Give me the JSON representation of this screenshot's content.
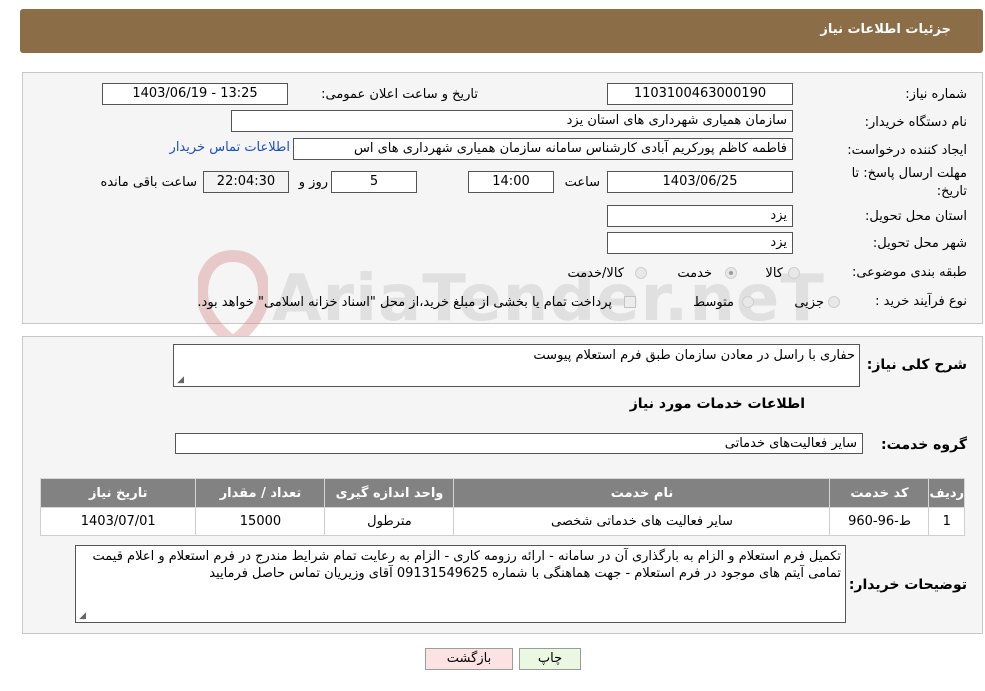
{
  "header": {
    "title": "جزئیات اطلاعات نیاز"
  },
  "watermark": "AriaTender.neT",
  "form": {
    "need_number_label": "شماره نیاز:",
    "need_number": "1103100463000190",
    "announce_label": "تاریخ و ساعت اعلان عمومی:",
    "announce_value": "1403/06/19 - 13:25",
    "buyer_org_label": "نام دستگاه خریدار:",
    "buyer_org": "سازمان همیاری شهرداری های استان یزد",
    "creator_label": "ایجاد کننده درخواست:",
    "creator": "فاطمه کاظم پورکریم آبادی کارشناس سامانه سازمان همیاری شهرداری های اس",
    "contact_link": "اطلاعات تماس خریدار",
    "deadline_label_1": "مهلت ارسال پاسخ: تا",
    "deadline_label_2": "تاریخ:",
    "deadline_date": "1403/06/25",
    "time_label": "ساعت",
    "deadline_time": "14:00",
    "days": "5",
    "days_label": "روز و",
    "remaining_time": "22:04:30",
    "remaining_label": "ساعت باقی مانده",
    "province_label": "استان محل تحویل:",
    "province": "یزد",
    "city_label": "شهر محل تحویل:",
    "city": "یزد",
    "category_label": "طبقه بندی موضوعی:",
    "category_options": [
      "کالا",
      "خدمت",
      "کالا/خدمت"
    ],
    "category_selected": "خدمت",
    "purchase_type_label": "نوع فرآیند خرید :",
    "purchase_options": [
      "جزیی",
      "متوسط"
    ],
    "payment_note": "پرداخت تمام یا بخشی از مبلغ خرید،از محل \"اسناد خزانه اسلامی\" خواهد بود."
  },
  "details": {
    "general_desc_label": "شرح کلی نیاز:",
    "general_desc": "حفاری با راسل در معادن سازمان طبق فرم استعلام پیوست",
    "services_title": "اطلاعات خدمات مورد نیاز",
    "service_group_label": "گروه خدمت:",
    "service_group": "سایر فعالیت‌های خدماتی",
    "table": {
      "headers": [
        "ردیف",
        "کد خدمت",
        "نام خدمت",
        "واحد اندازه گیری",
        "تعداد / مقدار",
        "تاریخ نیاز"
      ],
      "rows": [
        [
          "1",
          "ط-96-960",
          "سایر فعالیت های خدماتی شخصی",
          "مترطول",
          "15000",
          "1403/07/01"
        ]
      ]
    },
    "buyer_notes_label": "توضیحات خریدار:",
    "buyer_notes": "تکمیل فرم استعلام و الزام به بارگذاری آن در سامانه - ارائه رزومه کاری - الزام به رعایت تمام شرایط مندرج در فرم استعلام و اعلام قیمت تمامی آیتم های موجود در فرم استعلام - جهت هماهنگی با شماره 09131549625 آقای وزیریان تماس حاصل فرمایید"
  },
  "buttons": {
    "print": "چاپ",
    "back": "بازگشت"
  },
  "colors": {
    "header_bg": "#8b6d47",
    "table_header_bg": "#828282",
    "print_bg": "#eaf8e2",
    "back_bg": "#fbe3e3",
    "link": "#1a4fc8"
  }
}
